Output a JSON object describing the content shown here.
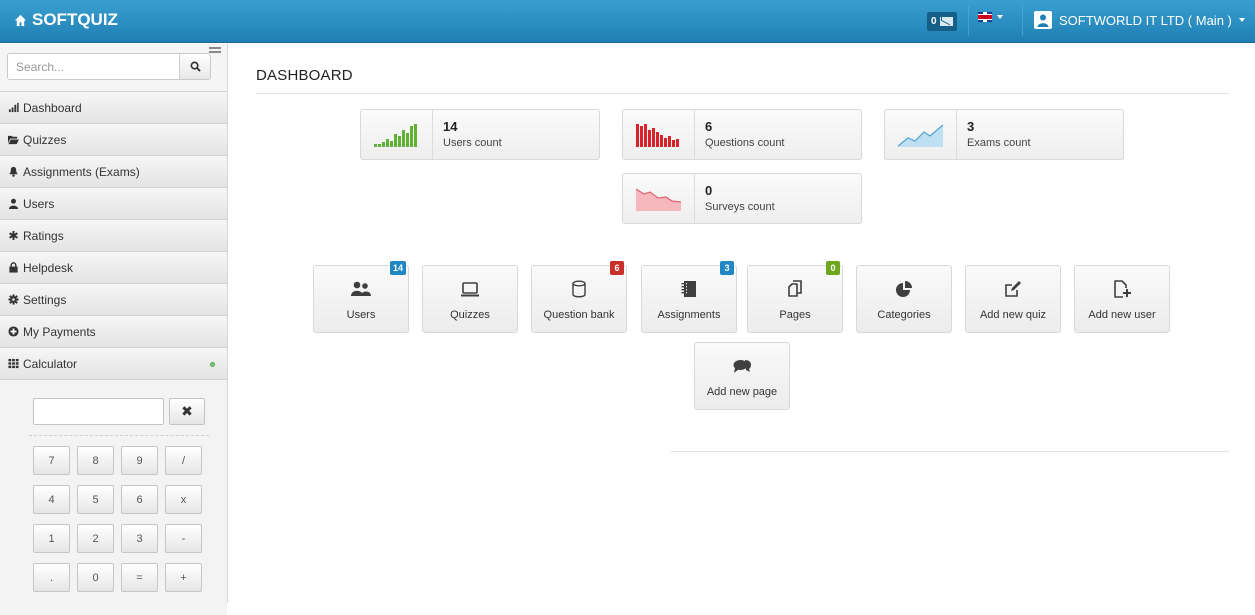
{
  "app": {
    "brand": "SOFTQUIZ"
  },
  "topbar": {
    "mail_count": "0",
    "user_label": "SOFTWORLD IT LTD ( Main )"
  },
  "sidebar": {
    "search_placeholder": "Search...",
    "items": [
      {
        "label": "Dashboard",
        "icon": "bar-chart-icon"
      },
      {
        "label": "Quizzes",
        "icon": "folder-open-icon"
      },
      {
        "label": "Assignments (Exams)",
        "icon": "bell-icon"
      },
      {
        "label": "Users",
        "icon": "user-icon"
      },
      {
        "label": "Ratings",
        "icon": "asterisk-icon"
      },
      {
        "label": "Helpdesk",
        "icon": "lock-icon"
      },
      {
        "label": "Settings",
        "icon": "cog-icon"
      },
      {
        "label": "My Payments",
        "icon": "plus-circle-icon"
      },
      {
        "label": "Calculator",
        "icon": "grid-icon"
      }
    ]
  },
  "calculator": {
    "clear_label": "✖",
    "rows": [
      [
        "7",
        "8",
        "9",
        "/"
      ],
      [
        "4",
        "5",
        "6",
        "x"
      ],
      [
        "1",
        "2",
        "3",
        "-"
      ],
      [
        ".",
        "0",
        "=",
        "+"
      ]
    ]
  },
  "page": {
    "title": "DASHBOARD"
  },
  "stats": [
    {
      "value": "14",
      "label": "Users count",
      "color": "#5fb233"
    },
    {
      "value": "6",
      "label": "Questions count",
      "color": "#d9232b"
    },
    {
      "value": "3",
      "label": "Exams count",
      "color": "#6fb3d9"
    },
    {
      "value": "0",
      "label": "Surveys count",
      "color": "#f08a94"
    }
  ],
  "quick_buttons": [
    {
      "label": "Users",
      "badge": "14",
      "badge_color": "#1e87c4",
      "icon": "users-icon"
    },
    {
      "label": "Quizzes",
      "badge": "",
      "icon": "laptop-icon"
    },
    {
      "label": "Question bank",
      "badge": "6",
      "badge_color": "#c9302c",
      "icon": "database-icon"
    },
    {
      "label": "Assignments",
      "badge": "3",
      "badge_color": "#1e87c4",
      "icon": "notebook-icon"
    },
    {
      "label": "Pages",
      "badge": "0",
      "badge_color": "#6ea61f",
      "icon": "pages-icon"
    },
    {
      "label": "Categories",
      "badge": "",
      "icon": "pie-chart-icon"
    },
    {
      "label": "Add new quiz",
      "badge": "",
      "icon": "edit-icon"
    },
    {
      "label": "Add new user",
      "badge": "",
      "icon": "file-plus-icon"
    },
    {
      "label": "Add new page",
      "badge": "",
      "icon": "comments-icon"
    }
  ]
}
